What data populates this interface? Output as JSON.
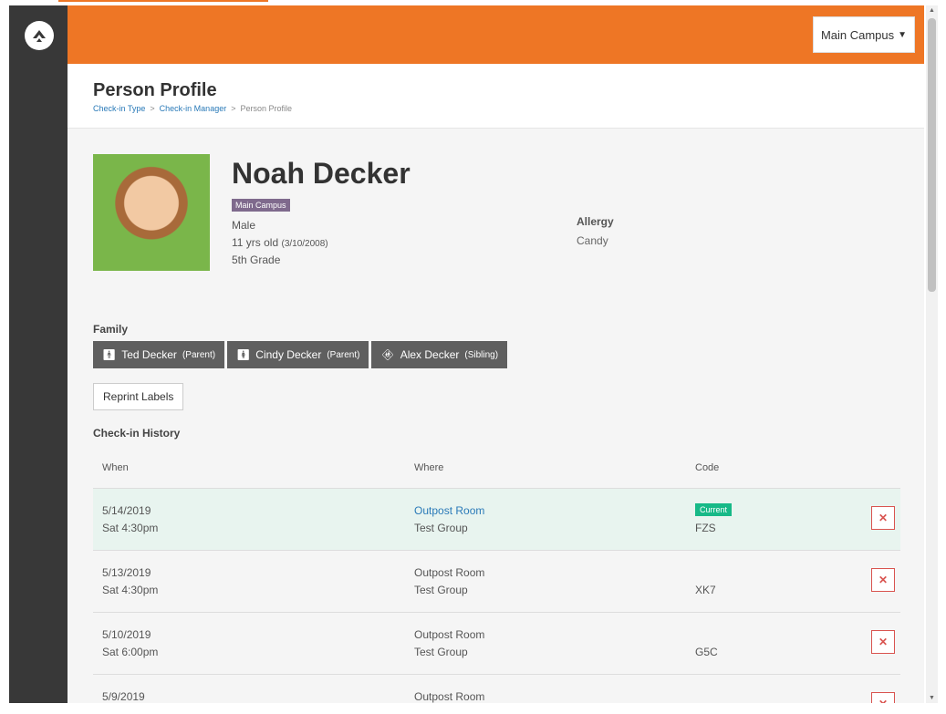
{
  "header": {
    "campus_button": "Main Campus"
  },
  "page": {
    "title": "Person Profile",
    "breadcrumbs": [
      "Check-in Type",
      "Check-in Manager",
      "Person Profile"
    ]
  },
  "person": {
    "name": "Noah Decker",
    "campus": "Main Campus",
    "gender": "Male",
    "age": "11 yrs old",
    "birthdate": "(3/10/2008)",
    "grade": "5th Grade",
    "allergy_label": "Allergy",
    "allergy_value": "Candy"
  },
  "family": {
    "label": "Family",
    "members": [
      {
        "name": "Ted Decker",
        "relation": "(Parent)"
      },
      {
        "name": "Cindy Decker",
        "relation": "(Parent)"
      },
      {
        "name": "Alex Decker",
        "relation": "(Sibling)"
      }
    ]
  },
  "reprint_label": "Reprint Labels",
  "history": {
    "label": "Check-in History",
    "columns": [
      "When",
      "Where",
      "Code"
    ],
    "current_badge": "Current",
    "rows": [
      {
        "date": "5/14/2019",
        "time": "Sat 4:30pm",
        "location": "Outpost Room",
        "group": "Test Group",
        "code": "FZS"
      },
      {
        "date": "5/13/2019",
        "time": "Sat 4:30pm",
        "location": "Outpost Room",
        "group": "Test Group",
        "code": "XK7"
      },
      {
        "date": "5/10/2019",
        "time": "Sat 6:00pm",
        "location": "Outpost Room",
        "group": "Test Group",
        "code": "G5C"
      },
      {
        "date": "5/9/2019",
        "time": "",
        "location": "Outpost Room",
        "group": "",
        "code": ""
      }
    ]
  },
  "colors": {
    "accent": "#ee7625",
    "sidebar": "#383838",
    "link": "#2a7ab8",
    "current": "#17b987",
    "danger": "#d9534f"
  }
}
